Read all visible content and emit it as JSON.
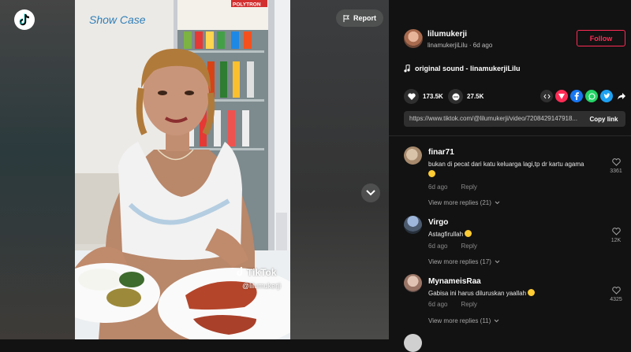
{
  "header": {
    "report_label": "Report"
  },
  "video": {
    "watermark": "TikTok",
    "watermark_user": "@lilumukerji",
    "sign_text": "Show Case",
    "brand_text": "POLYTRON"
  },
  "author": {
    "name": "lilumukerji",
    "sub": "linamukerjiLilu · 6d ago",
    "follow_label": "Follow"
  },
  "sound": {
    "label": "original sound - linamukerjiLilu"
  },
  "stats": {
    "likes": "173.5K",
    "comments": "27.5K"
  },
  "link": {
    "url": "https://www.tiktok.com/@lilumukerji/video/7208429147918...",
    "copy_label": "Copy link"
  },
  "comments": [
    {
      "name": "finar71",
      "text": "bukan di pecat dari katu keluarga lagi,tp dr kartu agama",
      "date": "6d ago",
      "reply": "Reply",
      "more": "View more replies (21)",
      "likes": "3361"
    },
    {
      "name": "Virgo",
      "text": "Astagfirullah",
      "date": "6d ago",
      "reply": "Reply",
      "more": "View more replies (17)",
      "likes": "12K"
    },
    {
      "name": "MynameisRaa",
      "text": "Gabisa ini harus diluruskan yaallah",
      "date": "6d ago",
      "reply": "Reply",
      "more": "View more replies (11)",
      "likes": "4325"
    }
  ],
  "colors": {
    "accent": "#fe2c55",
    "bg": "#121212"
  }
}
